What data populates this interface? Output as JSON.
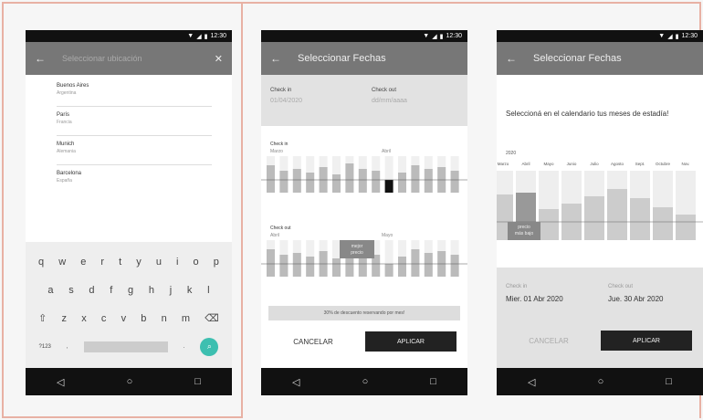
{
  "status": {
    "time": "12:30"
  },
  "screen1": {
    "back_icon": "←",
    "search_placeholder": "Seleccionar ubicación",
    "close_icon": "✕",
    "results": [
      {
        "city": "Buenos Aires",
        "country": "Argentina"
      },
      {
        "city": "París",
        "country": "Francia"
      },
      {
        "city": "Munich",
        "country": "Alemania"
      },
      {
        "city": "Barcelona",
        "country": "España"
      }
    ],
    "keys_row1": [
      "q",
      "w",
      "e",
      "r",
      "t",
      "y",
      "u",
      "i",
      "o",
      "p"
    ],
    "keys_row2": [
      "a",
      "s",
      "d",
      "f",
      "g",
      "h",
      "j",
      "k",
      "l"
    ],
    "keys_row3": [
      "⇧",
      "z",
      "x",
      "c",
      "v",
      "b",
      "n",
      "m",
      "⌫"
    ],
    "key_symbols": "?123",
    "key_comma": ",",
    "key_period": ".",
    "key_go": "⌕"
  },
  "screen2": {
    "title": "Seleccionar Fechas",
    "checkin_label": "Check in",
    "checkin_value": "01/04/2020",
    "checkout_label": "Check out",
    "checkout_value": "dd/mm/aaaa",
    "cal1_label": "Check in",
    "cal1_month_a": "Marzo",
    "cal1_month_b": "Abril",
    "cal2_label": "Check out",
    "cal2_month_a": "Abril",
    "cal2_month_b": "Mayo",
    "tooltip_line1": "mejor",
    "tooltip_line2": "precio",
    "discount_text": "30% de descuento reservando por mes!",
    "cancel_label": "CANCELAR",
    "apply_label": "APLICAR"
  },
  "screen3": {
    "title": "Seleccionar Fechas",
    "instruction": "Seleccioná en el calendario tus meses de estadía!",
    "year": "2020",
    "months": [
      "Marzo",
      "Abril",
      "Mayo",
      "Junio",
      "Julio",
      "Agosto",
      "Sept.",
      "Octubre",
      "Nov."
    ],
    "tooltip_line1": "precio",
    "tooltip_line2": "más bajo",
    "checkin_label": "Check in",
    "checkin_date": "Mier. 01 Abr 2020",
    "checkout_label": "Check out",
    "checkout_date": "Jue. 30 Abr 2020",
    "cancel_label": "CANCELAR",
    "apply_label": "APLICAR"
  },
  "nav": {
    "back": "◁",
    "home": "○",
    "recent": "□"
  }
}
